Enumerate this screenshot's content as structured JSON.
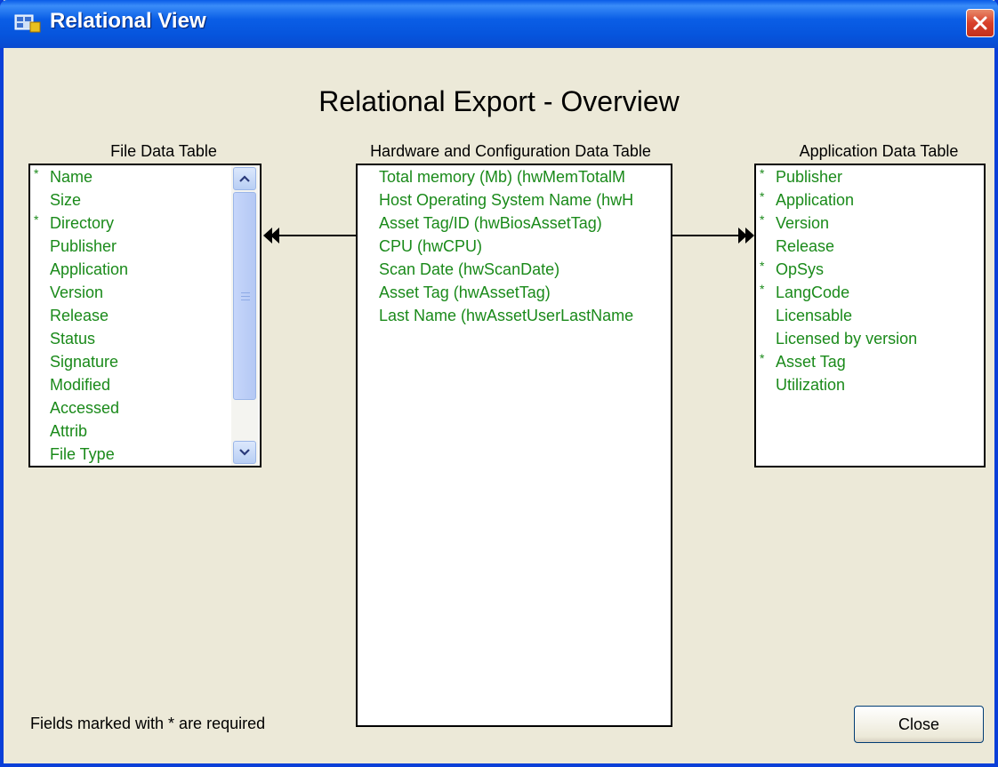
{
  "window": {
    "title": "Relational View"
  },
  "heading": "Relational Export - Overview",
  "file_table": {
    "label": "File Data Table",
    "items": [
      {
        "label": "Name",
        "req": "*"
      },
      {
        "label": "Size",
        "req": ""
      },
      {
        "label": "Directory",
        "req": "*"
      },
      {
        "label": "Publisher",
        "req": ""
      },
      {
        "label": "Application",
        "req": ""
      },
      {
        "label": "Version",
        "req": ""
      },
      {
        "label": "Release",
        "req": ""
      },
      {
        "label": "Status",
        "req": ""
      },
      {
        "label": "Signature",
        "req": ""
      },
      {
        "label": "Modified",
        "req": ""
      },
      {
        "label": "Accessed",
        "req": ""
      },
      {
        "label": "Attrib",
        "req": ""
      },
      {
        "label": "File Type",
        "req": ""
      }
    ]
  },
  "hardware_table": {
    "label": "Hardware and Configuration Data Table",
    "items": [
      {
        "label": "Total memory (Mb) (hwMemTotalM"
      },
      {
        "label": "Host Operating System Name (hwH"
      },
      {
        "label": "Asset Tag/ID (hwBiosAssetTag)"
      },
      {
        "label": "CPU (hwCPU)"
      },
      {
        "label": "Scan Date (hwScanDate)"
      },
      {
        "label": "Asset Tag (hwAssetTag)"
      },
      {
        "label": "Last Name (hwAssetUserLastName"
      }
    ]
  },
  "application_table": {
    "label": "Application Data Table",
    "items": [
      {
        "label": "Publisher",
        "req": "*"
      },
      {
        "label": "Application",
        "req": "*"
      },
      {
        "label": "Version",
        "req": "*"
      },
      {
        "label": "Release",
        "req": ""
      },
      {
        "label": "OpSys",
        "req": "*"
      },
      {
        "label": "LangCode",
        "req": "*"
      },
      {
        "label": "Licensable",
        "req": ""
      },
      {
        "label": "Licensed by version",
        "req": ""
      },
      {
        "label": "Asset Tag",
        "req": "*"
      },
      {
        "label": "Utilization",
        "req": ""
      }
    ]
  },
  "footer": {
    "note": "Fields marked with * are required",
    "close_label": "Close"
  },
  "colors": {
    "field_text": "#1a8a1a",
    "title_bar": "#0a5ce8"
  },
  "icons": {
    "app": "relational-view-icon",
    "close": "close-icon"
  }
}
